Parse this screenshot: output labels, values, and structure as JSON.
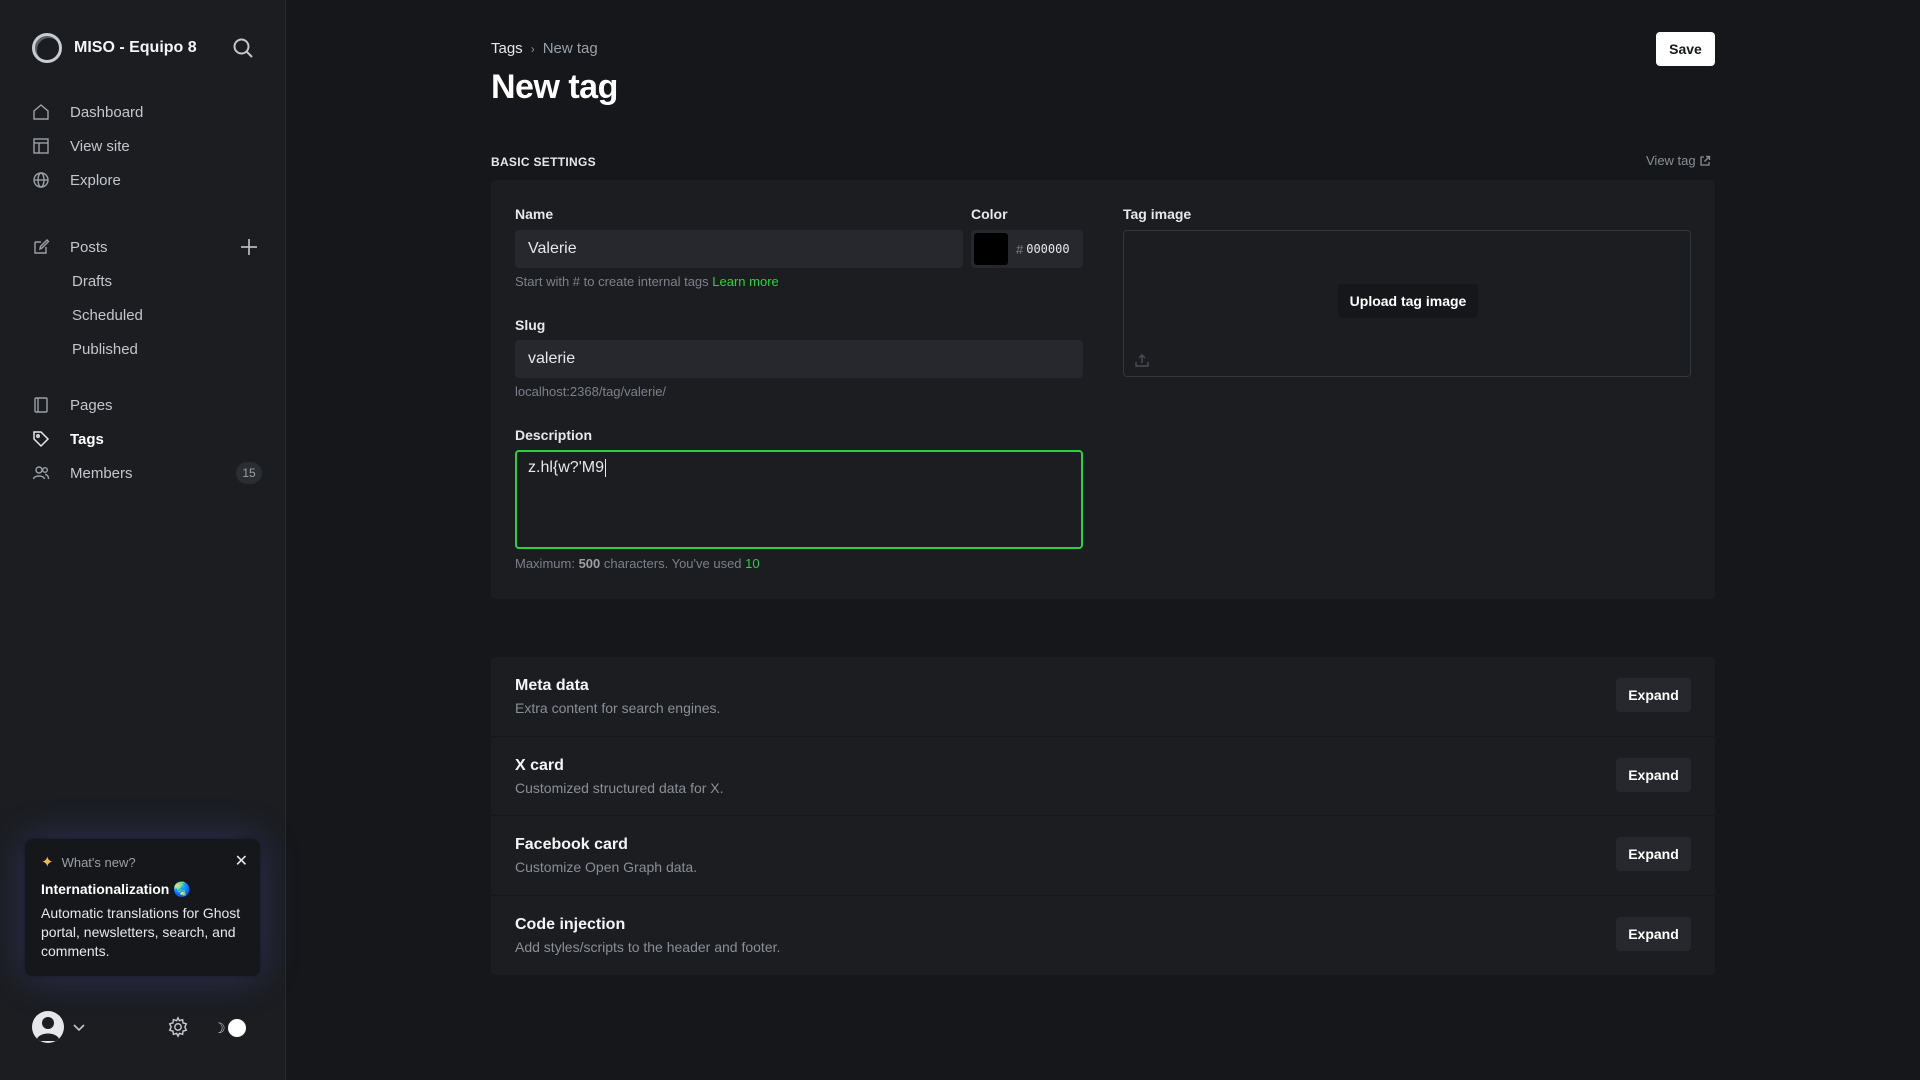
{
  "sidebar": {
    "site_name": "MISO - Equipo 8",
    "nav": {
      "dashboard": "Dashboard",
      "view_site": "View site",
      "explore": "Explore",
      "posts": "Posts",
      "drafts": "Drafts",
      "scheduled": "Scheduled",
      "published": "Published",
      "pages": "Pages",
      "tags": "Tags",
      "members": "Members",
      "members_count": "15"
    },
    "whats_new": {
      "heading": "What's new?",
      "title": "Internationalization 🌏",
      "body": "Automatic translations for Ghost portal, newsletters, search, and comments."
    }
  },
  "header": {
    "breadcrumb_parent": "Tags",
    "breadcrumb_current": "New tag",
    "title": "New tag",
    "save_label": "Save"
  },
  "basic_settings": {
    "label": "BASIC SETTINGS",
    "view_tag": "View tag",
    "name": {
      "label": "Name",
      "value": "Valerie",
      "hint_text": "Start with # to create internal tags",
      "hint_link": "Learn more"
    },
    "color": {
      "label": "Color",
      "hash": "#",
      "value": "000000",
      "swatch": "#000000"
    },
    "slug": {
      "label": "Slug",
      "value": "valerie",
      "url": "localhost:2368/tag/valerie/"
    },
    "description": {
      "label": "Description",
      "value": "z.hl{w?'M9",
      "max_prefix": "Maximum:",
      "max_value": "500",
      "max_suffix": "characters. You've used",
      "used": "10"
    },
    "tag_image": {
      "label": "Tag image",
      "upload_label": "Upload tag image"
    }
  },
  "expand_sections": [
    {
      "title": "Meta data",
      "desc": "Extra content for search engines.",
      "button": "Expand"
    },
    {
      "title": "X card",
      "desc": "Customized structured data for X.",
      "button": "Expand"
    },
    {
      "title": "Facebook card",
      "desc": "Customize Open Graph data.",
      "button": "Expand"
    },
    {
      "title": "Code injection",
      "desc": "Add styles/scripts to the header and footer.",
      "button": "Expand"
    }
  ],
  "colors": {
    "accent_green": "#30cf43",
    "background": "#15171a",
    "card": "#1b1d21"
  }
}
